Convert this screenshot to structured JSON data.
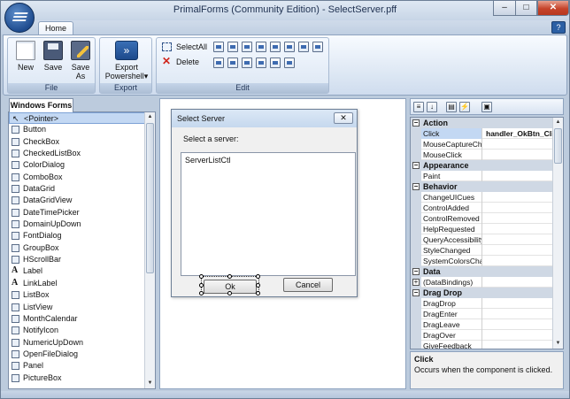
{
  "window": {
    "title": "PrimalForms (Community Edition) - SelectServer.pff",
    "min": "–",
    "max": "□",
    "close": "✕"
  },
  "ribbon": {
    "tab": "Home",
    "help": "?",
    "file_group": "File",
    "export_group": "Export",
    "edit_group": "Edit",
    "new": "New",
    "save": "Save",
    "save_as_line1": "Save",
    "save_as_line2": "As",
    "export_line1": "Export",
    "export_line2": "Powershell▾",
    "select_all": "SelectAll",
    "delete": "Delete"
  },
  "toolbox": {
    "tab": "Windows Forms",
    "items": [
      "<Pointer>",
      "Button",
      "CheckBox",
      "CheckedListBox",
      "ColorDialog",
      "ComboBox",
      "DataGrid",
      "DataGridView",
      "DateTimePicker",
      "DomainUpDown",
      "FontDialog",
      "GroupBox",
      "HScrollBar",
      "Label",
      "LinkLabel",
      "ListBox",
      "ListView",
      "MonthCalendar",
      "NotifyIcon",
      "NumericUpDown",
      "OpenFileDialog",
      "Panel",
      "PictureBox"
    ]
  },
  "dialog": {
    "title": "Select Server",
    "close": "✕",
    "prompt": "Select a server:",
    "list_item": "ServerListCtl",
    "ok": "Ok",
    "cancel": "Cancel"
  },
  "properties": {
    "cat_action": "Action",
    "click_name": "Click",
    "click_value": "handler_OkBtn_Click",
    "mousecapture": "MouseCaptureChanged",
    "mouseclick": "MouseClick",
    "cat_appearance": "Appearance",
    "paint": "Paint",
    "cat_behavior": "Behavior",
    "changeuicues": "ChangeUICues",
    "controladded": "ControlAdded",
    "controlremoved": "ControlRemoved",
    "helprequested": "HelpRequested",
    "queryaccessibility": "QueryAccessibilityHelp",
    "stylechanged": "StyleChanged",
    "systemcolors": "SystemColorsChanged",
    "cat_data": "Data",
    "databindings": "(DataBindings)",
    "cat_dragdrop": "Drag Drop",
    "dragdrop": "DragDrop",
    "dragenter": "DragEnter",
    "dragleave": "DragLeave",
    "dragover": "DragOver",
    "givefeedback": "GiveFeedback",
    "desc_title": "Click",
    "desc_text": "Occurs when the component is clicked."
  }
}
